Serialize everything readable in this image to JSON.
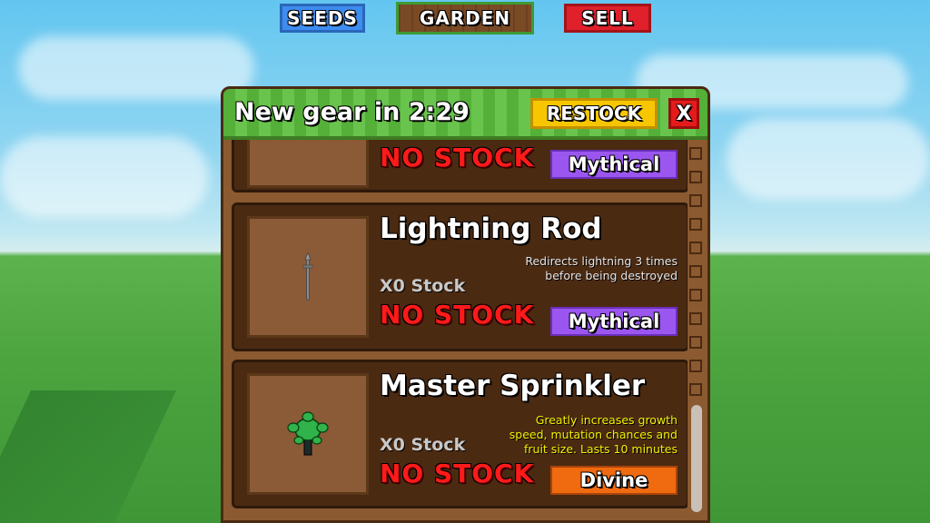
{
  "nav": {
    "seeds_label": "SEEDS",
    "garden_label": "GARDEN",
    "sell_label": "SELL"
  },
  "shop": {
    "title": "New gear in 2:29",
    "restock_label": "RESTOCK",
    "close_label": "X",
    "items": [
      {
        "name": "",
        "stock": "",
        "status": "NO STOCK",
        "rarity": "Mythical",
        "description": "",
        "icon": "hidden-item-icon"
      },
      {
        "name": "Lightning Rod",
        "stock": "X0 Stock",
        "status": "NO STOCK",
        "rarity": "Mythical",
        "description": "Redirects lightning 3 times before being destroyed",
        "icon": "lightning-rod-icon"
      },
      {
        "name": "Master Sprinkler",
        "stock": "X0 Stock",
        "status": "NO STOCK",
        "rarity": "Divine",
        "description": "Greatly increases growth speed, mutation chances and fruit size. Lasts 10 minutes",
        "icon": "sprinkler-icon"
      }
    ]
  },
  "colors": {
    "mythical": "#9b56f0",
    "divine": "#f06a10",
    "no_stock": "#ff1a1a",
    "restock": "#f7c600",
    "close": "#e51b1b"
  }
}
